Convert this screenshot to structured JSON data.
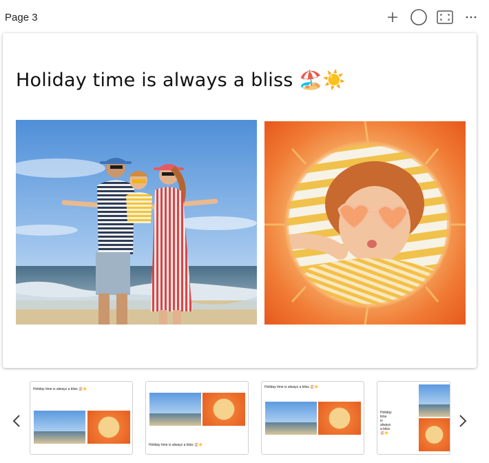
{
  "header": {
    "page_label": "Page 3",
    "toolbar": {
      "add_icon": "plus-icon",
      "shape_icon": "circle-icon",
      "fit_icon": "frame-icon",
      "more_icon": "ellipsis-icon"
    }
  },
  "page": {
    "title": "Holiday time is always a bliss 🏖️☀️",
    "photos": [
      {
        "name": "beach-family-photo"
      },
      {
        "name": "swim-ring-child-photo"
      }
    ]
  },
  "thumbnails": {
    "items": [
      {
        "caption": "Holiday time is always a bliss 🏖️☀️"
      },
      {
        "caption": "Holiday time is always a bliss 🏖️☀️"
      },
      {
        "caption": "Holiday time is always a bliss 🏖️☀️"
      },
      {
        "caption_lines": [
          "Holiday",
          "time",
          "is",
          "always",
          "a bliss",
          "🏖️☀️"
        ]
      }
    ],
    "prev_icon": "chevron-left-icon",
    "next_icon": "chevron-right-icon"
  },
  "colors": {
    "sky": "#6fa7e3",
    "sea": "#5b7f98",
    "orange": "#f06a28",
    "accent_yellow": "#f5c84a"
  }
}
